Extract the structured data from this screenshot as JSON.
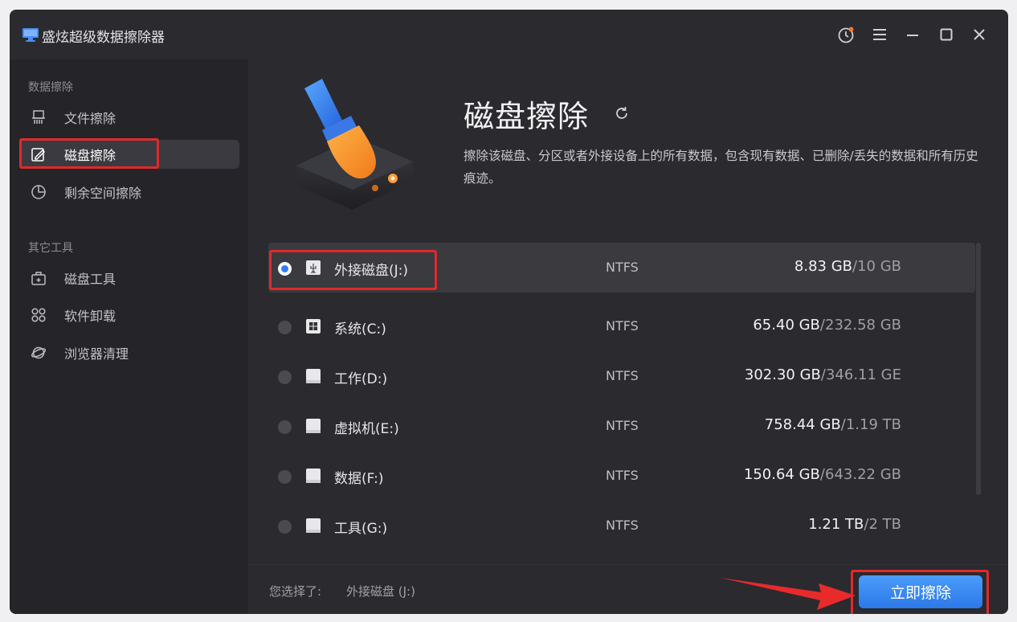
{
  "app": {
    "title": "盛炫超级数据擦除器",
    "icon": "monitor-icon"
  },
  "window_controls": [
    "clock-update-icon",
    "menu-icon",
    "minimize-icon",
    "maximize-icon",
    "close-icon"
  ],
  "sidebar": {
    "section_data": "数据擦除",
    "section_tools": "其它工具",
    "items": [
      {
        "label": "文件擦除",
        "icon": "file-shred-icon"
      },
      {
        "label": "磁盘擦除",
        "icon": "disk-wipe-icon",
        "active": true
      },
      {
        "label": "剩余空间擦除",
        "icon": "pie-chart-icon"
      },
      {
        "label": "磁盘工具",
        "icon": "toolbox-icon"
      },
      {
        "label": "软件卸载",
        "icon": "apps-icon"
      },
      {
        "label": "浏览器清理",
        "icon": "browser-icon"
      }
    ]
  },
  "main": {
    "title": "磁盘擦除",
    "description": "擦除该磁盘、分区或者外接设备上的所有数据，包含现有数据、已删除/丢失的数据和所有历史痕迹。",
    "disks": [
      {
        "name": "外接磁盘(J:)",
        "fs": "NTFS",
        "used": "8.83 GB",
        "total": "/10 GB",
        "selected": true,
        "icon": "usb-drive-icon"
      },
      {
        "name": "系统(C:)",
        "fs": "NTFS",
        "used": "65.40 GB",
        "total": "/232.58 GB",
        "icon": "windows-drive-icon"
      },
      {
        "name": "工作(D:)",
        "fs": "NTFS",
        "used": "302.30 GB",
        "total": "/346.11 GE",
        "icon": "drive-icon"
      },
      {
        "name": "虚拟机(E:)",
        "fs": "NTFS",
        "used": "758.44 GB",
        "total": "/1.19 TB",
        "icon": "drive-icon"
      },
      {
        "name": "数据(F:)",
        "fs": "NTFS",
        "used": "150.64 GB",
        "total": "/643.22 GB",
        "icon": "drive-icon"
      },
      {
        "name": "工具(G:)",
        "fs": "NTFS",
        "used": "1.21 TB",
        "total": "/2 TB",
        "icon": "drive-icon"
      }
    ]
  },
  "footer": {
    "selected_label": "您选择了:",
    "selected_value": "外接磁盘 (J:)",
    "wipe_button": "立即擦除"
  },
  "colors": {
    "accent": "#2f7ef6",
    "highlight": "#e02a2a",
    "bg": "#2a2a2f"
  }
}
